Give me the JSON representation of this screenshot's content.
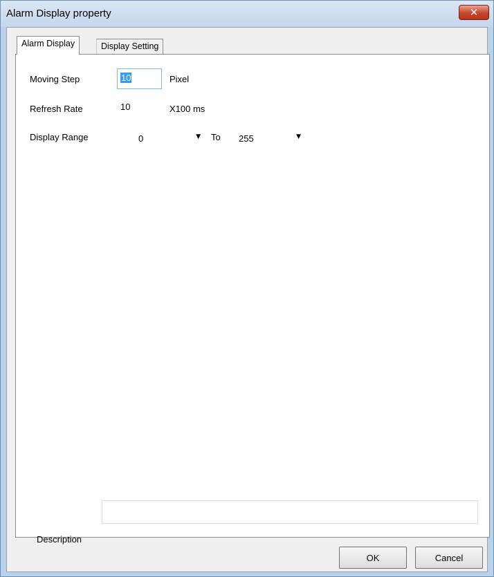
{
  "window": {
    "title": "Alarm Display property",
    "close_glyph": "✕"
  },
  "tabs": [
    {
      "label": "Alarm Display",
      "active": true
    },
    {
      "label": "Display Setting",
      "active": false
    }
  ],
  "form": {
    "moving_step": {
      "label": "Moving Step",
      "value": "10",
      "unit": "Pixel"
    },
    "refresh_rate": {
      "label": "Refresh Rate",
      "value": "10",
      "unit": "X100 ms"
    },
    "display_range": {
      "label": "Display Range",
      "from": "0",
      "to_label": "To",
      "to": "255",
      "arrow": "▼"
    },
    "description": {
      "label": "Description",
      "value": ""
    }
  },
  "buttons": {
    "ok": "OK",
    "cancel": "Cancel"
  },
  "colors": {
    "titlebar": "#c4d7ec",
    "close_button": "#c7442a",
    "selection": "#3399ff"
  }
}
